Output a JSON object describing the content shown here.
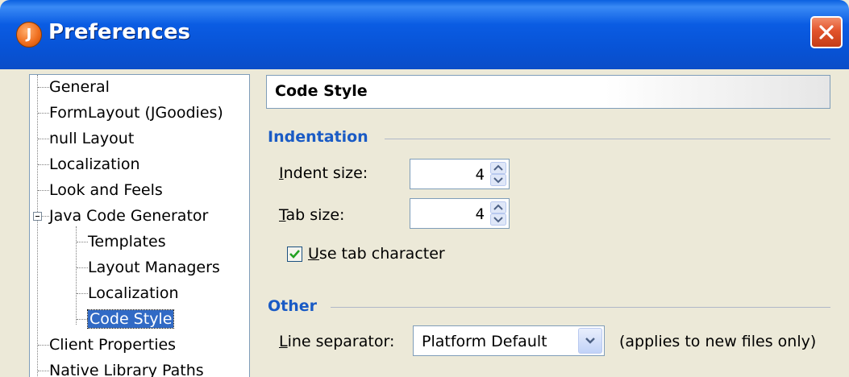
{
  "window": {
    "title": "Preferences",
    "app_icon_letter": "J"
  },
  "tree": {
    "items": [
      {
        "label": "General",
        "level": 0
      },
      {
        "label": "FormLayout (JGoodies)",
        "level": 0
      },
      {
        "label": "null Layout",
        "level": 0
      },
      {
        "label": "Localization",
        "level": 0
      },
      {
        "label": "Look and Feels",
        "level": 0
      },
      {
        "label": "Java Code Generator",
        "level": 0,
        "expanded": true
      },
      {
        "label": "Templates",
        "level": 1
      },
      {
        "label": "Layout Managers",
        "level": 1
      },
      {
        "label": "Localization",
        "level": 1
      },
      {
        "label": "Code Style",
        "level": 1,
        "selected": true
      },
      {
        "label": "Client Properties",
        "level": 0
      },
      {
        "label": "Native Library Paths",
        "level": 0
      }
    ]
  },
  "panel": {
    "header": "Code Style",
    "indentation": {
      "title": "Indentation",
      "indent_size_label": "Indent size:",
      "indent_size_mnemonic": "I",
      "indent_size_rest": "ndent size:",
      "indent_size_value": "4",
      "tab_size_mnemonic": "T",
      "tab_size_rest": "ab size:",
      "tab_size_value": "4",
      "use_tab_mnemonic": "U",
      "use_tab_rest": "se tab character",
      "use_tab_checked": true
    },
    "other": {
      "title": "Other",
      "line_sep_mnemonic": "L",
      "line_sep_rest": "ine separator:",
      "line_sep_value": "Platform Default",
      "line_sep_note": "(applies to new files only)"
    }
  },
  "colors": {
    "title_blue": "#0a5ce3",
    "section_blue": "#1a5bc5",
    "selection": "#316ac5",
    "close_red": "#e2542c",
    "check_green": "#21a121"
  }
}
